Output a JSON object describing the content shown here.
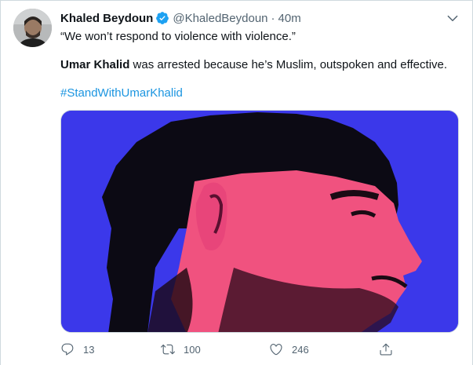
{
  "author": {
    "name": "Khaled Beydoun",
    "handle": "@KhaledBeydoun",
    "separator": "·",
    "time": "40m"
  },
  "tweet": {
    "line1": "“We won’t respond to violence with violence.”",
    "line2_bold": "Umar Khalid",
    "line2_rest": " was arrested because he’s Muslim, outspoken and effective.",
    "hashtag": "#StandWithUmarKhalid"
  },
  "actions": {
    "replies": "13",
    "retweets": "100",
    "likes": "246"
  },
  "colors": {
    "link": "#1b95e0",
    "verified": "#1da1f2",
    "media_background": "#3b38ea",
    "media_face": "#f0527f"
  }
}
